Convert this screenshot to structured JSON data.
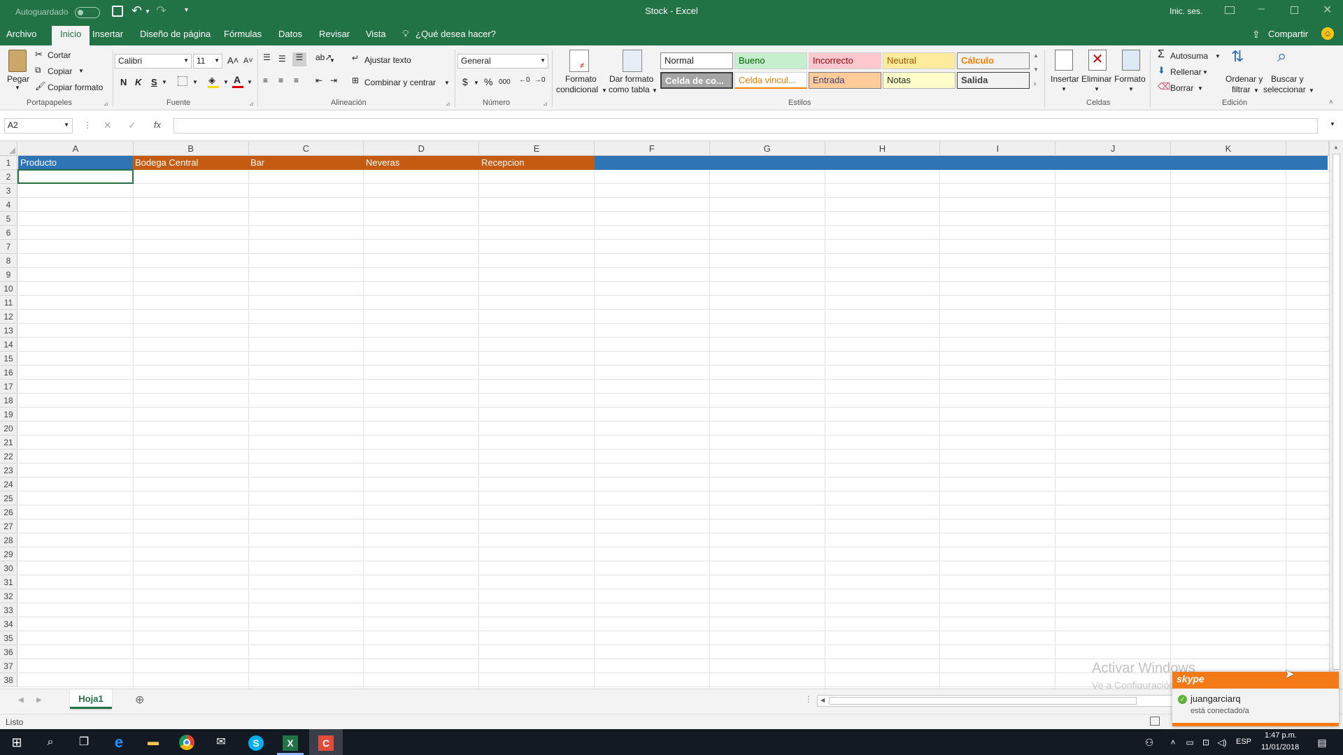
{
  "titlebar": {
    "autosave_label": "Autoguardado",
    "title": "Stock - Excel",
    "signin": "Inic. ses."
  },
  "tabs": [
    "Archivo",
    "Inicio",
    "Insertar",
    "Diseño de página",
    "Fórmulas",
    "Datos",
    "Revisar",
    "Vista"
  ],
  "tell_me": "¿Qué desea hacer?",
  "share": "Compartir",
  "clipboard": {
    "paste": "Pegar",
    "cut": "Cortar",
    "copy": "Copiar",
    "format_painter": "Copiar formato",
    "label": "Portapapeles"
  },
  "font": {
    "name": "Calibri",
    "size": "11",
    "bold": "N",
    "italic": "K",
    "underline": "S",
    "label": "Fuente"
  },
  "alignment": {
    "wrap": "Ajustar texto",
    "merge": "Combinar y centrar",
    "label": "Alineación"
  },
  "number": {
    "format": "General",
    "currency": "$",
    "percent": "%",
    "thousands": "000",
    "label": "Número"
  },
  "styles": {
    "cond_format_1": "Formato",
    "cond_format_2": "condicional",
    "as_table_1": "Dar formato",
    "as_table_2": "como tabla",
    "normal": "Normal",
    "good": "Bueno",
    "bad": "Incorrecto",
    "neutral": "Neutral",
    "calc": "Cálculo",
    "check": "Celda de co...",
    "linked": "Celda vincul...",
    "input": "Entrada",
    "note": "Notas",
    "output": "Salida",
    "label": "Estilos"
  },
  "cells_group": {
    "insert": "Insertar",
    "delete": "Eliminar",
    "format": "Formato",
    "label": "Celdas"
  },
  "editing": {
    "autosum": "Autosuma",
    "fill": "Rellenar",
    "clear": "Borrar",
    "sort_1": "Ordenar y",
    "sort_2": "filtrar",
    "find_1": "Buscar y",
    "find_2": "seleccionar",
    "label": "Edición"
  },
  "formula_bar": {
    "name_box": "A2",
    "fx": "fx",
    "value": ""
  },
  "columns": [
    "A",
    "B",
    "C",
    "D",
    "E",
    "F",
    "G",
    "H",
    "I",
    "J",
    "K"
  ],
  "rows": [
    "1",
    "2",
    "3",
    "4",
    "5",
    "6",
    "7",
    "8",
    "9",
    "10",
    "11",
    "12",
    "13",
    "14",
    "15",
    "16",
    "17",
    "18",
    "19",
    "20",
    "21",
    "22",
    "23",
    "24",
    "25",
    "26",
    "27",
    "28",
    "29",
    "30",
    "31",
    "32",
    "33",
    "34",
    "35",
    "36",
    "37",
    "38"
  ],
  "header_row": [
    "Producto",
    "Bodega Central",
    "Bar",
    "Neveras",
    "Recepcion"
  ],
  "colors": {
    "excel_green": "#217346",
    "blue_fill": "#2e75b6",
    "orange_fill": "#c55a11",
    "skype_orange": "#f37a16"
  },
  "sheet_tab": "Hoja1",
  "status": "Listo",
  "watermark": {
    "line1": "Activar Windows",
    "line2": "Ve a Configuración para activar Windows."
  },
  "skype": {
    "brand": "skype",
    "user": "juangarciarq",
    "status": "está conectado/a"
  },
  "taskbar": {
    "lang": "ESP",
    "time": "1:47 p.m.",
    "date": "11/01/2018"
  }
}
